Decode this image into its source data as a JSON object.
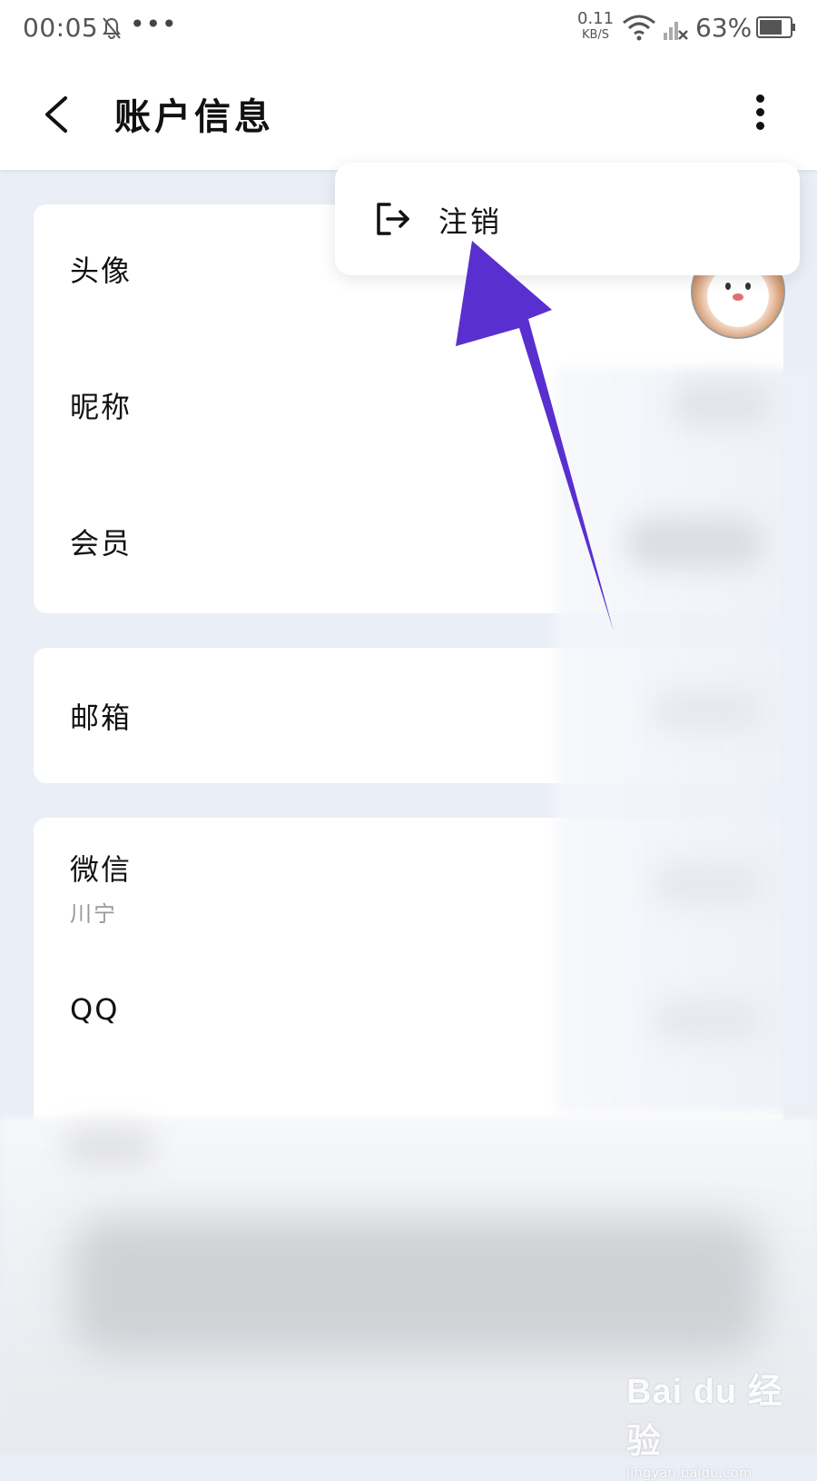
{
  "status_bar": {
    "time": "00:05",
    "dots": "•••",
    "net_speed_value": "0.11",
    "net_speed_unit": "KB/S",
    "battery_percent": "63%"
  },
  "header": {
    "title": "账户信息"
  },
  "menu": {
    "items": [
      {
        "label": "注销",
        "icon": "logout-icon"
      }
    ]
  },
  "sections": {
    "profile": [
      {
        "label": "头像"
      },
      {
        "label": "昵称"
      },
      {
        "label": "会员"
      }
    ],
    "email": [
      {
        "label": "邮箱"
      }
    ],
    "bindings": [
      {
        "label": "微信",
        "sub": "川宁"
      },
      {
        "label": "QQ"
      }
    ]
  },
  "annotation": {
    "arrow_color": "#5a2fcf"
  },
  "watermark": {
    "logo": "Bai du 经验",
    "url": "jingyan.baidu.com"
  }
}
